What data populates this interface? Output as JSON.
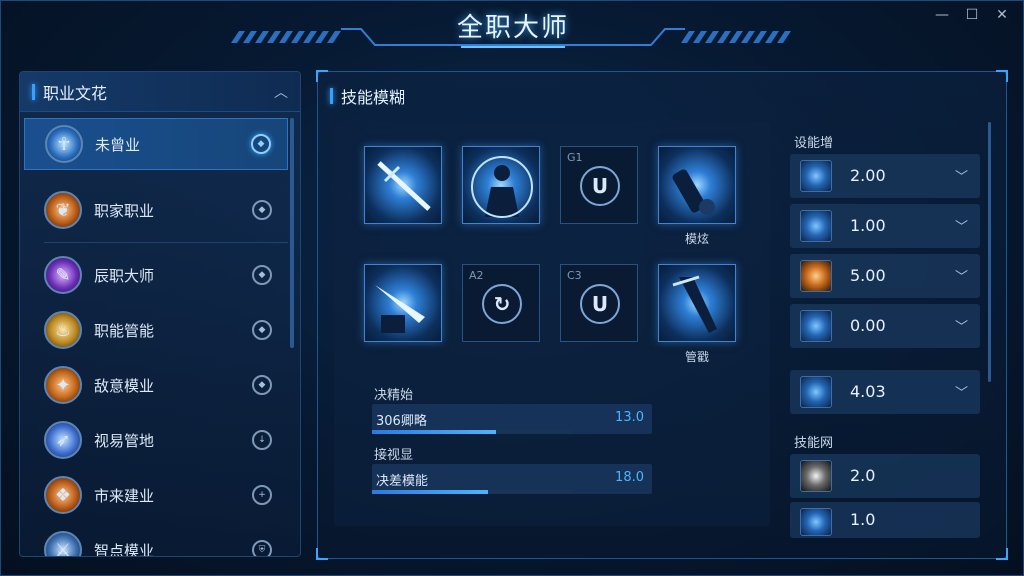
{
  "window": {
    "title": "全职大师",
    "controls": {
      "minimize": "—",
      "maximize": "☐",
      "close": "✕"
    }
  },
  "left_panel": {
    "title": "职业文花",
    "collapse_icon": "chevron-up-icon",
    "items": [
      {
        "label": "未曾业",
        "icon": "silhouette-icon",
        "selected": true
      },
      {
        "label": "职家职业",
        "icon": "leaf-icon",
        "selected": false
      },
      {
        "label": "辰职大师",
        "icon": "feather-icon",
        "selected": false
      },
      {
        "label": "职能管能",
        "icon": "flame-icon",
        "selected": false
      },
      {
        "label": "敌意模业",
        "icon": "claw-icon",
        "selected": false
      },
      {
        "label": "视易管地",
        "icon": "arrow-icon",
        "selected": false
      },
      {
        "label": "市来建业",
        "icon": "crest-icon",
        "selected": false
      },
      {
        "label": "智点模业",
        "icon": "sword-icon",
        "selected": false
      }
    ]
  },
  "main_panel": {
    "title": "技能模糊",
    "slots": [
      {
        "code": "",
        "glyph": "",
        "caption": "",
        "filled": true,
        "art": "sword-icon"
      },
      {
        "code": "",
        "glyph": "",
        "caption": "",
        "filled": true,
        "art": "figure-icon"
      },
      {
        "code": "G1",
        "glyph": "U",
        "caption": "",
        "filled": false,
        "art": ""
      },
      {
        "code": "",
        "glyph": "",
        "caption": "模炫",
        "filled": true,
        "art": "cannon-icon"
      },
      {
        "code": "",
        "glyph": "",
        "caption": "",
        "filled": true,
        "art": "blade-icon"
      },
      {
        "code": "A2",
        "glyph": "↻",
        "caption": "",
        "filled": false,
        "art": ""
      },
      {
        "code": "C3",
        "glyph": "U",
        "caption": "",
        "filled": false,
        "art": ""
      },
      {
        "code": "",
        "glyph": "",
        "caption": "管戳",
        "filled": true,
        "art": "dagger-icon"
      }
    ],
    "bars": [
      {
        "label": "决精始",
        "name": "306卿略",
        "value": "13.0",
        "fill": 0.62
      },
      {
        "label": "接视显",
        "name": "决差模能",
        "value": "18.0",
        "fill": 0.58
      }
    ]
  },
  "right_column": {
    "header": "设能增",
    "stats": [
      {
        "value": "2.00",
        "icon": "crystal-icon",
        "tone": "blue"
      },
      {
        "value": "1.00",
        "icon": "slash-icon",
        "tone": "blue"
      },
      {
        "value": "5.00",
        "icon": "helmet-icon",
        "tone": "orange"
      },
      {
        "value": "0.00",
        "icon": "spear-icon",
        "tone": "blue"
      }
    ],
    "extra_stat": {
      "value": "4.03",
      "icon": "burst-icon",
      "tone": "blue"
    },
    "section2_header": "技能网",
    "stats2": [
      {
        "value": "2.0",
        "icon": "splash-icon",
        "tone": "gray"
      },
      {
        "value": "1.0",
        "icon": "spire-icon",
        "tone": "blue"
      }
    ]
  },
  "colors": {
    "accent": "#3aa0ff",
    "background": "#071a33",
    "panel_border": "#1e5592",
    "value_blue": "#4db4ff"
  }
}
